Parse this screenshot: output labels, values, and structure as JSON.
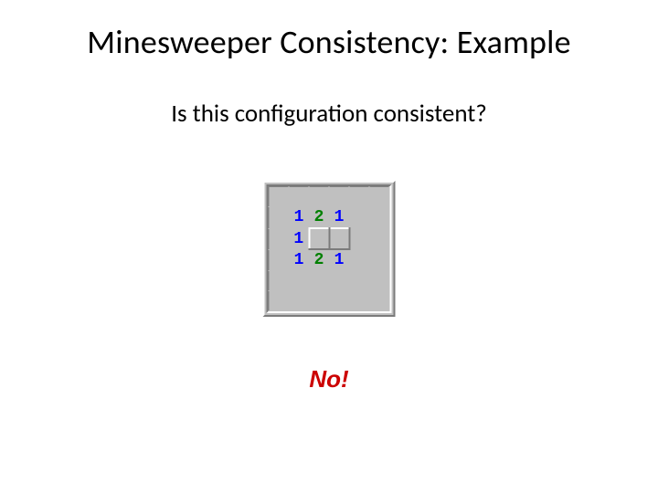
{
  "title": "Minesweeper Consistency: Example",
  "question": "Is this configuration consistent?",
  "answer": "No!",
  "board": {
    "rows": 6,
    "cols": 6,
    "cells": [
      [
        {
          "s": "rev",
          "v": ""
        },
        {
          "s": "rev",
          "v": ""
        },
        {
          "s": "rev",
          "v": ""
        },
        {
          "s": "rev",
          "v": ""
        },
        {
          "s": "rev",
          "v": ""
        },
        {
          "s": "rev",
          "v": ""
        }
      ],
      [
        {
          "s": "rev",
          "v": ""
        },
        {
          "s": "rev",
          "v": "1"
        },
        {
          "s": "rev",
          "v": "2"
        },
        {
          "s": "rev",
          "v": "1"
        },
        {
          "s": "rev",
          "v": ""
        },
        {
          "s": "rev",
          "v": ""
        }
      ],
      [
        {
          "s": "rev",
          "v": ""
        },
        {
          "s": "rev",
          "v": "1"
        },
        {
          "s": "cov",
          "v": ""
        },
        {
          "s": "cov",
          "v": ""
        },
        {
          "s": "rev",
          "v": ""
        },
        {
          "s": "rev",
          "v": ""
        }
      ],
      [
        {
          "s": "rev",
          "v": ""
        },
        {
          "s": "rev",
          "v": "1"
        },
        {
          "s": "rev",
          "v": "2"
        },
        {
          "s": "rev",
          "v": "1"
        },
        {
          "s": "rev",
          "v": ""
        },
        {
          "s": "rev",
          "v": ""
        }
      ],
      [
        {
          "s": "rev",
          "v": ""
        },
        {
          "s": "rev",
          "v": ""
        },
        {
          "s": "rev",
          "v": ""
        },
        {
          "s": "rev",
          "v": ""
        },
        {
          "s": "rev",
          "v": ""
        },
        {
          "s": "rev",
          "v": ""
        }
      ],
      [
        {
          "s": "rev",
          "v": ""
        },
        {
          "s": "rev",
          "v": ""
        },
        {
          "s": "rev",
          "v": ""
        },
        {
          "s": "rev",
          "v": ""
        },
        {
          "s": "rev",
          "v": ""
        },
        {
          "s": "rev",
          "v": ""
        }
      ]
    ]
  }
}
